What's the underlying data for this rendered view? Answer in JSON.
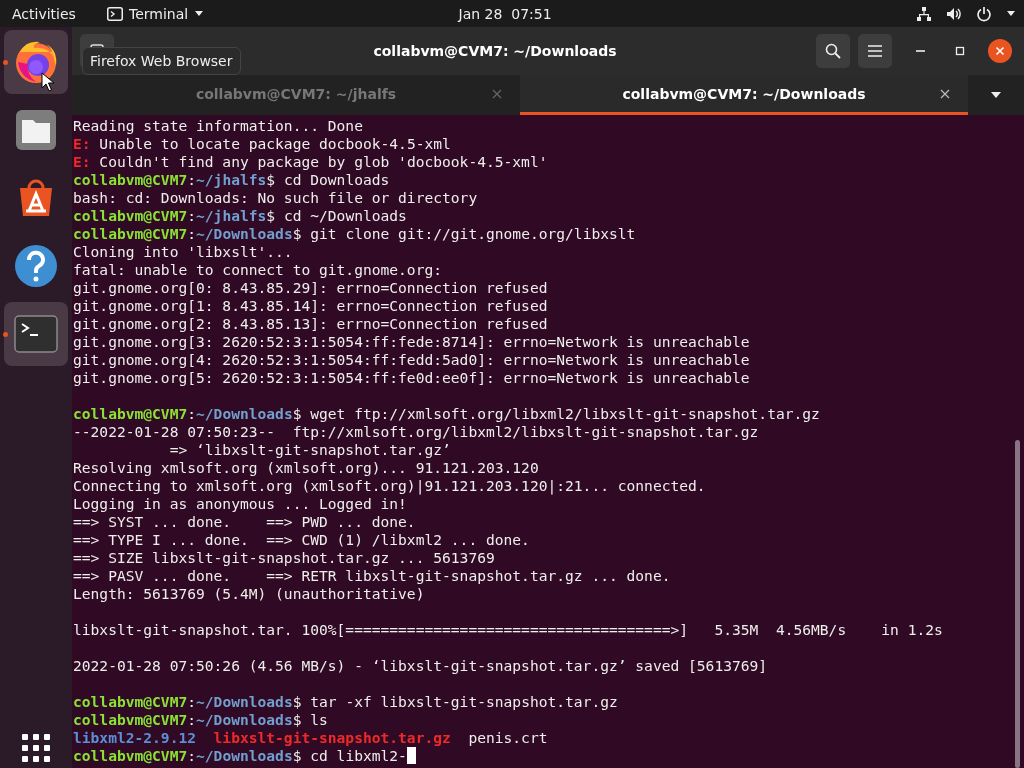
{
  "top_bar": {
    "activities": "Activities",
    "app_menu": "Terminal",
    "clock": "Jan 28  07:51"
  },
  "dock": {
    "items": [
      {
        "kind": "firefox",
        "running": true,
        "highlighted": true
      },
      {
        "kind": "files",
        "running": false,
        "highlighted": false
      },
      {
        "kind": "software",
        "running": false,
        "highlighted": false
      },
      {
        "kind": "help",
        "running": false,
        "highlighted": false
      },
      {
        "kind": "terminal",
        "running": true,
        "highlighted": true
      }
    ]
  },
  "tooltip": "Firefox Web Browser",
  "window": {
    "title": "collabvm@CVM7: ~/Downloads"
  },
  "tabs": [
    {
      "label": "collabvm@CVM7: ~/jhalfs",
      "selected": false
    },
    {
      "label": "collabvm@CVM7: ~/Downloads",
      "selected": true
    }
  ],
  "terminal": {
    "lines": [
      {
        "kind": "text",
        "segments": [
          {
            "kind": "plain",
            "text": "Reading state information... Done"
          }
        ]
      },
      {
        "kind": "text",
        "segments": [
          {
            "kind": "error",
            "text": "E:"
          },
          {
            "kind": "plain",
            "text": " Unable to locate package docbook-4.5-xml"
          }
        ]
      },
      {
        "kind": "text",
        "segments": [
          {
            "kind": "error",
            "text": "E:"
          },
          {
            "kind": "plain",
            "text": " Couldn't find any package by glob 'docbook-4.5-xml'"
          }
        ]
      },
      {
        "kind": "text",
        "segments": [
          {
            "kind": "user",
            "text": "collabvm@CVM7"
          },
          {
            "kind": "plain",
            "text": ":"
          },
          {
            "kind": "path",
            "text": "~/jhalfs"
          },
          {
            "kind": "plain",
            "text": "$ cd Downloads"
          }
        ]
      },
      {
        "kind": "text",
        "segments": [
          {
            "kind": "plain",
            "text": "bash: cd: Downloads: No such file or directory"
          }
        ]
      },
      {
        "kind": "text",
        "segments": [
          {
            "kind": "user",
            "text": "collabvm@CVM7"
          },
          {
            "kind": "plain",
            "text": ":"
          },
          {
            "kind": "path",
            "text": "~/jhalfs"
          },
          {
            "kind": "plain",
            "text": "$ cd ~/Downloads"
          }
        ]
      },
      {
        "kind": "text",
        "segments": [
          {
            "kind": "user",
            "text": "collabvm@CVM7"
          },
          {
            "kind": "plain",
            "text": ":"
          },
          {
            "kind": "path",
            "text": "~/Downloads"
          },
          {
            "kind": "plain",
            "text": "$ git clone git://git.gnome.org/libxslt"
          }
        ]
      },
      {
        "kind": "text",
        "segments": [
          {
            "kind": "plain",
            "text": "Cloning into 'libxslt'..."
          }
        ]
      },
      {
        "kind": "text",
        "segments": [
          {
            "kind": "plain",
            "text": "fatal: unable to connect to git.gnome.org:"
          }
        ]
      },
      {
        "kind": "text",
        "segments": [
          {
            "kind": "plain",
            "text": "git.gnome.org[0: 8.43.85.29]: errno=Connection refused"
          }
        ]
      },
      {
        "kind": "text",
        "segments": [
          {
            "kind": "plain",
            "text": "git.gnome.org[1: 8.43.85.14]: errno=Connection refused"
          }
        ]
      },
      {
        "kind": "text",
        "segments": [
          {
            "kind": "plain",
            "text": "git.gnome.org[2: 8.43.85.13]: errno=Connection refused"
          }
        ]
      },
      {
        "kind": "text",
        "segments": [
          {
            "kind": "plain",
            "text": "git.gnome.org[3: 2620:52:3:1:5054:ff:fede:8714]: errno=Network is unreachable"
          }
        ]
      },
      {
        "kind": "text",
        "segments": [
          {
            "kind": "plain",
            "text": "git.gnome.org[4: 2620:52:3:1:5054:ff:fedd:5ad0]: errno=Network is unreachable"
          }
        ]
      },
      {
        "kind": "text",
        "segments": [
          {
            "kind": "plain",
            "text": "git.gnome.org[5: 2620:52:3:1:5054:ff:fe0d:ee0f]: errno=Network is unreachable"
          }
        ]
      },
      {
        "kind": "blank"
      },
      {
        "kind": "text",
        "segments": [
          {
            "kind": "user",
            "text": "collabvm@CVM7"
          },
          {
            "kind": "plain",
            "text": ":"
          },
          {
            "kind": "path",
            "text": "~/Downloads"
          },
          {
            "kind": "plain",
            "text": "$ wget ftp://xmlsoft.org/libxml2/libxslt-git-snapshot.tar.gz"
          }
        ]
      },
      {
        "kind": "text",
        "segments": [
          {
            "kind": "plain",
            "text": "--2022-01-28 07:50:23--  ftp://xmlsoft.org/libxml2/libxslt-git-snapshot.tar.gz"
          }
        ]
      },
      {
        "kind": "text",
        "segments": [
          {
            "kind": "plain",
            "text": "           => ‘libxslt-git-snapshot.tar.gz’"
          }
        ]
      },
      {
        "kind": "text",
        "segments": [
          {
            "kind": "plain",
            "text": "Resolving xmlsoft.org (xmlsoft.org)... 91.121.203.120"
          }
        ]
      },
      {
        "kind": "text",
        "segments": [
          {
            "kind": "plain",
            "text": "Connecting to xmlsoft.org (xmlsoft.org)|91.121.203.120|:21... connected."
          }
        ]
      },
      {
        "kind": "text",
        "segments": [
          {
            "kind": "plain",
            "text": "Logging in as anonymous ... Logged in!"
          }
        ]
      },
      {
        "kind": "text",
        "segments": [
          {
            "kind": "plain",
            "text": "==> SYST ... done.    ==> PWD ... done."
          }
        ]
      },
      {
        "kind": "text",
        "segments": [
          {
            "kind": "plain",
            "text": "==> TYPE I ... done.  ==> CWD (1) /libxml2 ... done."
          }
        ]
      },
      {
        "kind": "text",
        "segments": [
          {
            "kind": "plain",
            "text": "==> SIZE libxslt-git-snapshot.tar.gz ... 5613769"
          }
        ]
      },
      {
        "kind": "text",
        "segments": [
          {
            "kind": "plain",
            "text": "==> PASV ... done.    ==> RETR libxslt-git-snapshot.tar.gz ... done."
          }
        ]
      },
      {
        "kind": "text",
        "segments": [
          {
            "kind": "plain",
            "text": "Length: 5613769 (5.4M) (unauthoritative)"
          }
        ]
      },
      {
        "kind": "blank"
      },
      {
        "kind": "text",
        "segments": [
          {
            "kind": "plain",
            "text": "libxslt-git-snapshot.tar. 100%[=====================================>]   5.35M  4.56MB/s    in 1.2s"
          }
        ]
      },
      {
        "kind": "blank"
      },
      {
        "kind": "text",
        "segments": [
          {
            "kind": "plain",
            "text": "2022-01-28 07:50:26 (4.56 MB/s) - ‘libxslt-git-snapshot.tar.gz’ saved [5613769]"
          }
        ]
      },
      {
        "kind": "blank"
      },
      {
        "kind": "text",
        "segments": [
          {
            "kind": "user",
            "text": "collabvm@CVM7"
          },
          {
            "kind": "plain",
            "text": ":"
          },
          {
            "kind": "path",
            "text": "~/Downloads"
          },
          {
            "kind": "plain",
            "text": "$ tar -xf libxslt-git-snapshot.tar.gz"
          }
        ]
      },
      {
        "kind": "text",
        "segments": [
          {
            "kind": "user",
            "text": "collabvm@CVM7"
          },
          {
            "kind": "plain",
            "text": ":"
          },
          {
            "kind": "path",
            "text": "~/Downloads"
          },
          {
            "kind": "plain",
            "text": "$ ls"
          }
        ]
      },
      {
        "kind": "listing",
        "segments": [
          {
            "kind": "directory",
            "text": "libxml2-2.9.12"
          },
          {
            "kind": "archive",
            "text": "libxslt-git-snapshot.tar.gz"
          },
          {
            "kind": "plain",
            "text": "penis.crt"
          }
        ]
      },
      {
        "kind": "text",
        "cursor": true,
        "segments": [
          {
            "kind": "user",
            "text": "collabvm@CVM7"
          },
          {
            "kind": "plain",
            "text": ":"
          },
          {
            "kind": "path",
            "text": "~/Downloads"
          },
          {
            "kind": "plain",
            "text": "$ cd libxml2-"
          }
        ]
      }
    ]
  }
}
